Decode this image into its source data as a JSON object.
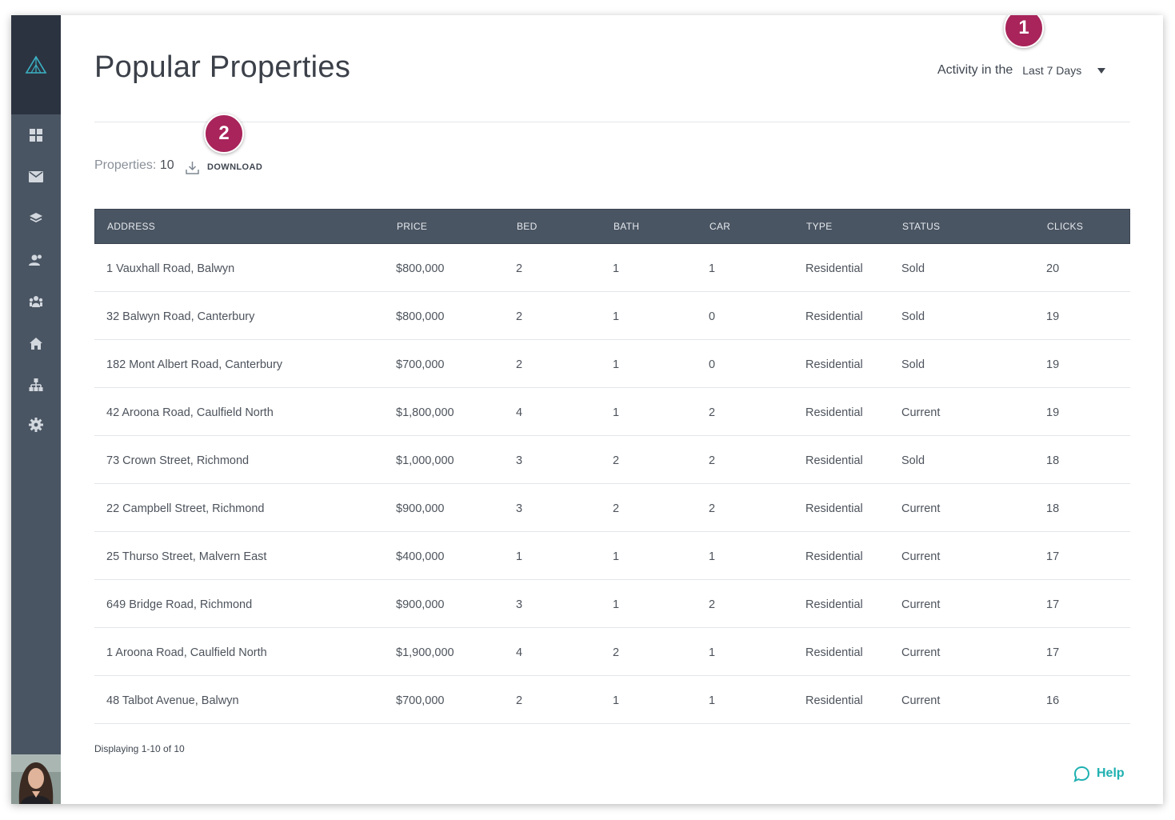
{
  "header": {
    "title": "Popular Properties",
    "activity_label": "Activity in the",
    "activity_period": "Last 7 Days"
  },
  "summary": {
    "count_label": "Properties:",
    "count_value": "10",
    "download_label": "DOWNLOAD"
  },
  "callouts": [
    "1",
    "2"
  ],
  "table": {
    "columns": [
      "ADDRESS",
      "PRICE",
      "BED",
      "BATH",
      "CAR",
      "TYPE",
      "STATUS",
      "CLICKS"
    ],
    "rows": [
      [
        "1 Vauxhall Road, Balwyn",
        "$800,000",
        "2",
        "1",
        "1",
        "Residential",
        "Sold",
        "20"
      ],
      [
        "32 Balwyn Road, Canterbury",
        "$800,000",
        "2",
        "1",
        "0",
        "Residential",
        "Sold",
        "19"
      ],
      [
        "182 Mont Albert Road, Canterbury",
        "$700,000",
        "2",
        "1",
        "0",
        "Residential",
        "Sold",
        "19"
      ],
      [
        "42 Aroona Road, Caulfield North",
        "$1,800,000",
        "4",
        "1",
        "2",
        "Residential",
        "Current",
        "19"
      ],
      [
        "73 Crown Street, Richmond",
        "$1,000,000",
        "3",
        "2",
        "2",
        "Residential",
        "Sold",
        "18"
      ],
      [
        "22 Campbell Street, Richmond",
        "$900,000",
        "3",
        "2",
        "2",
        "Residential",
        "Current",
        "18"
      ],
      [
        "25 Thurso Street, Malvern East",
        "$400,000",
        "1",
        "1",
        "1",
        "Residential",
        "Current",
        "17"
      ],
      [
        "649 Bridge Road, Richmond",
        "$900,000",
        "3",
        "1",
        "2",
        "Residential",
        "Current",
        "17"
      ],
      [
        "1 Aroona Road, Caulfield North",
        "$1,900,000",
        "4",
        "2",
        "1",
        "Residential",
        "Current",
        "17"
      ],
      [
        "48 Talbot Avenue, Balwyn",
        "$700,000",
        "2",
        "1",
        "1",
        "Residential",
        "Current",
        "16"
      ]
    ]
  },
  "footer": {
    "pagination": "Displaying 1-10 of 10",
    "help_label": "Help"
  },
  "sidebar": {
    "icons": [
      "dashboard-icon",
      "mail-icon",
      "layers-icon",
      "contacts-icon",
      "team-icon",
      "home-icon",
      "hierarchy-icon",
      "gear-icon"
    ]
  },
  "colors": {
    "sidebar": "#4a5563",
    "sidebar_logo_bg": "#2c3340",
    "table_header": "#4a5563",
    "badge": "#a8245a",
    "help_accent": "#1fb0b0",
    "logo_accent": "#3bb3c4"
  }
}
